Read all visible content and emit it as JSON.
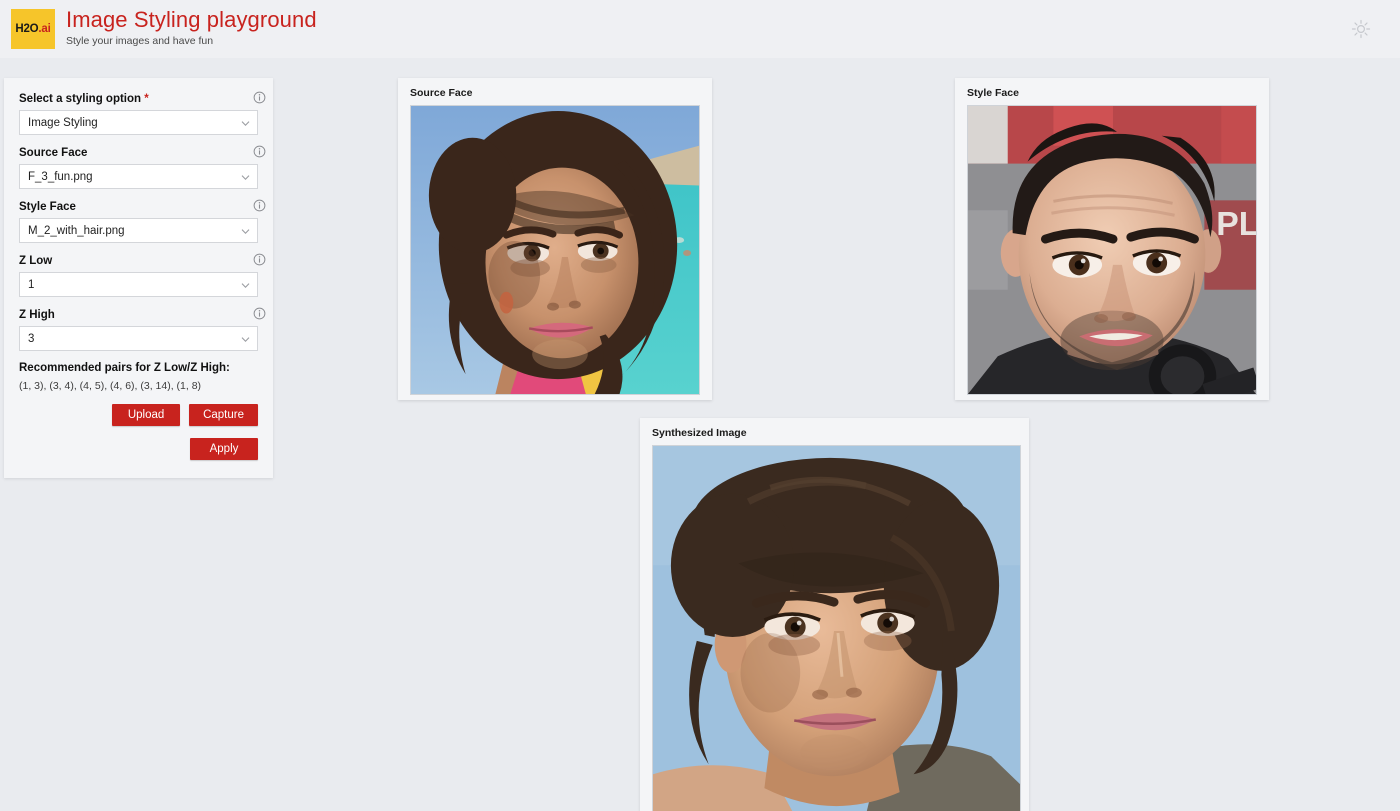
{
  "header": {
    "logo_main": "H2O",
    "logo_suffix": ".ai",
    "title": "Image Styling playground",
    "subtitle": "Style your images and have fun",
    "theme_toggle_icon": "sun-icon"
  },
  "sidebar": {
    "fields": [
      {
        "label": "Select a styling option",
        "required": true,
        "value": "Image Styling",
        "info_icon": "info-icon",
        "name": "styling-option"
      },
      {
        "label": "Source Face",
        "required": false,
        "value": "F_3_fun.png",
        "info_icon": "info-icon",
        "name": "source-face"
      },
      {
        "label": "Style Face",
        "required": false,
        "value": "M_2_with_hair.png",
        "info_icon": "info-icon",
        "name": "style-face"
      },
      {
        "label": "Z Low",
        "required": false,
        "value": "1",
        "info_icon": "info-icon",
        "name": "z-low"
      },
      {
        "label": "Z High",
        "required": false,
        "value": "3",
        "info_icon": "info-icon",
        "name": "z-high"
      }
    ],
    "recommended_title": "Recommended pairs for Z Low/Z High:",
    "recommended_pairs": "(1, 3), (3, 4), (4, 5), (4, 6), (3, 14), (1, 8)",
    "buttons": {
      "upload": "Upload",
      "capture": "Capture",
      "apply": "Apply"
    }
  },
  "cards": {
    "source": {
      "title": "Source Face"
    },
    "style": {
      "title": "Style Face"
    },
    "synthesized": {
      "title": "Synthesized Image"
    }
  },
  "colors": {
    "brand_red": "#c8231e",
    "logo_yellow": "#f6c52a",
    "page_background": "#e9ebef",
    "card_background": "#f4f5f7"
  }
}
